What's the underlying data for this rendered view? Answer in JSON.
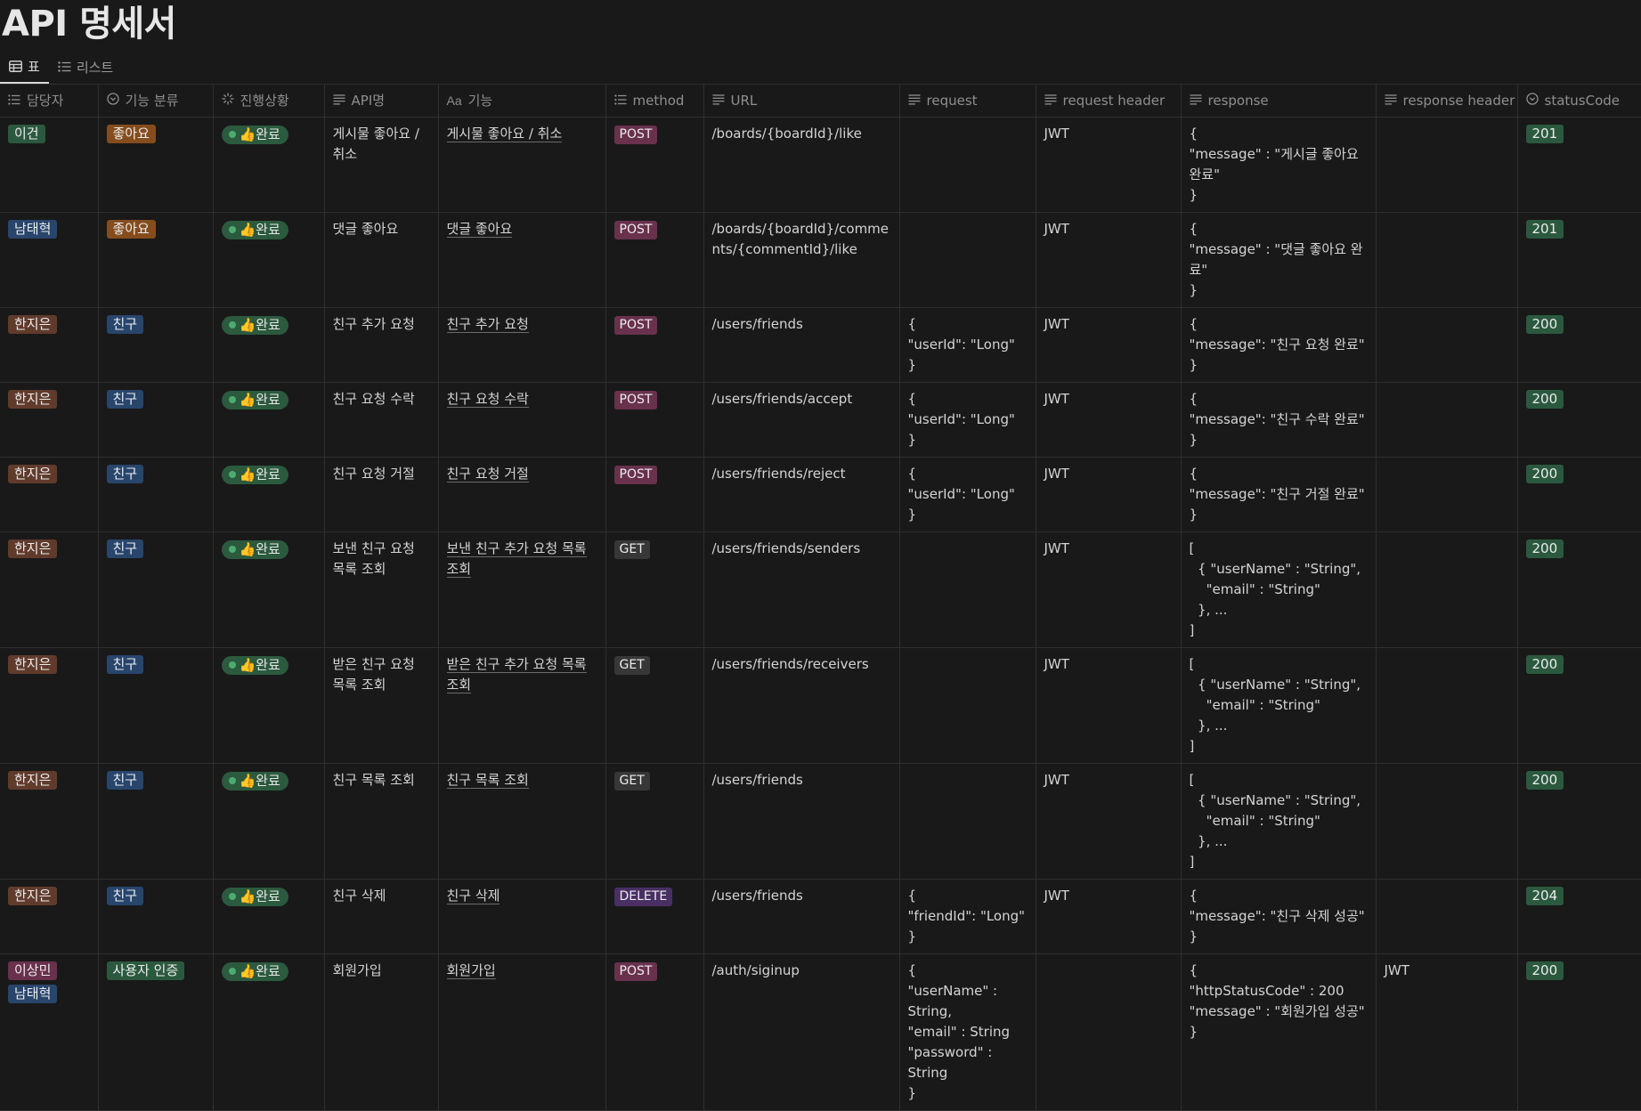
{
  "title": "API 명세서",
  "views": [
    {
      "label": "표",
      "icon": "table-icon",
      "active": true
    },
    {
      "label": "리스트",
      "icon": "list-icon",
      "active": false
    }
  ],
  "columns": [
    {
      "label": "담당자",
      "icon": "multi-select-icon"
    },
    {
      "label": "기능 분류",
      "icon": "select-icon"
    },
    {
      "label": "진행상황",
      "icon": "status-icon"
    },
    {
      "label": "API명",
      "icon": "text-icon"
    },
    {
      "label": "기능",
      "icon": "title-icon"
    },
    {
      "label": "method",
      "icon": "multi-select-icon"
    },
    {
      "label": "URL",
      "icon": "text-icon"
    },
    {
      "label": "request",
      "icon": "text-icon"
    },
    {
      "label": "request header",
      "icon": "text-icon"
    },
    {
      "label": "response",
      "icon": "text-icon"
    },
    {
      "label": "response header",
      "icon": "text-icon"
    },
    {
      "label": "statusCode",
      "icon": "select-icon"
    }
  ],
  "colors": {
    "pill_green": "#2b593f",
    "pill_brown": "#603b2c",
    "pill_blue": "#28456c",
    "pill_orange": "#854c1d",
    "pill_pink": "#69314c",
    "pill_purple": "#492f64",
    "pill_gray": "#373737",
    "status_bg": "#2b5a3e",
    "status_dot": "#4dab6f"
  },
  "rows": [
    {
      "owners": [
        {
          "label": "이건",
          "color": "green"
        }
      ],
      "category": {
        "label": "좋아요",
        "color": "orange"
      },
      "status": "👍완료",
      "api_name": "게시물 좋아요 / 취소",
      "feature": "게시물 좋아요 / 취소",
      "method": {
        "label": "POST",
        "color": "pink"
      },
      "url": "/boards/{boardId}/like",
      "request": "",
      "request_header": "JWT",
      "response": "{\n\"message\" : \"게시글 좋아요 완료\"\n}",
      "response_header": "",
      "status_code": "201"
    },
    {
      "owners": [
        {
          "label": "남태혁",
          "color": "blue"
        }
      ],
      "category": {
        "label": "좋아요",
        "color": "orange"
      },
      "status": "👍완료",
      "api_name": "댓글 좋아요",
      "feature": "댓글 좋아요",
      "method": {
        "label": "POST",
        "color": "pink"
      },
      "url": "/boards/{boardId}/comments/{commentId}/like",
      "request": "",
      "request_header": "JWT",
      "response": "{\n\"message\" : \"댓글 좋아요 완료\"\n}",
      "response_header": "",
      "status_code": "201"
    },
    {
      "owners": [
        {
          "label": "한지은",
          "color": "brown"
        }
      ],
      "category": {
        "label": "친구",
        "color": "blue"
      },
      "status": "👍완료",
      "api_name": "친구 추가 요청",
      "feature": "친구 추가 요청",
      "method": {
        "label": "POST",
        "color": "pink"
      },
      "url": "/users/friends",
      "request": "{\n\"userId\": \"Long\"\n}",
      "request_header": "JWT",
      "response": "{\n\"message\": \"친구 요청 완료\"\n}",
      "response_header": "",
      "status_code": "200"
    },
    {
      "owners": [
        {
          "label": "한지은",
          "color": "brown"
        }
      ],
      "category": {
        "label": "친구",
        "color": "blue"
      },
      "status": "👍완료",
      "api_name": "친구 요청 수락",
      "feature": "친구 요청 수락",
      "method": {
        "label": "POST",
        "color": "pink"
      },
      "url": "/users/friends/accept",
      "request": "{\n\"userId\": \"Long\"\n}",
      "request_header": "JWT",
      "response": "{\n\"message\": \"친구 수락 완료\"\n}",
      "response_header": "",
      "status_code": "200"
    },
    {
      "owners": [
        {
          "label": "한지은",
          "color": "brown"
        }
      ],
      "category": {
        "label": "친구",
        "color": "blue"
      },
      "status": "👍완료",
      "api_name": "친구 요청 거절",
      "feature": "친구 요청 거절",
      "method": {
        "label": "POST",
        "color": "pink"
      },
      "url": "/users/friends/reject",
      "request": "{\n\"userId\": \"Long\"\n}",
      "request_header": "JWT",
      "response": "{\n\"message\": \"친구 거절 완료\"\n}",
      "response_header": "",
      "status_code": "200"
    },
    {
      "owners": [
        {
          "label": "한지은",
          "color": "brown"
        }
      ],
      "category": {
        "label": "친구",
        "color": "blue"
      },
      "status": "👍완료",
      "api_name": "보낸 친구 요청 목록 조회",
      "feature": "보낸 친구 추가 요청 목록 조회",
      "method": {
        "label": "GET",
        "color": "gray"
      },
      "url": "/users/friends/senders",
      "request": "",
      "request_header": "JWT",
      "response": "[\n  { \"userName\" : \"String\",\n    \"email\" : \"String\"\n  }, ...\n]",
      "response_header": "",
      "status_code": "200"
    },
    {
      "owners": [
        {
          "label": "한지은",
          "color": "brown"
        }
      ],
      "category": {
        "label": "친구",
        "color": "blue"
      },
      "status": "👍완료",
      "api_name": "받은 친구 요청 목록 조회",
      "feature": "받은 친구 추가 요청 목록 조회",
      "method": {
        "label": "GET",
        "color": "gray"
      },
      "url": "/users/friends/receivers",
      "request": "",
      "request_header": "JWT",
      "response": "[\n  { \"userName\" : \"String\",\n    \"email\" : \"String\"\n  }, ...\n]",
      "response_header": "",
      "status_code": "200"
    },
    {
      "owners": [
        {
          "label": "한지은",
          "color": "brown"
        }
      ],
      "category": {
        "label": "친구",
        "color": "blue"
      },
      "status": "👍완료",
      "api_name": "친구 목록 조회",
      "feature": "친구 목록 조회",
      "method": {
        "label": "GET",
        "color": "gray"
      },
      "url": "/users/friends",
      "request": "",
      "request_header": "JWT",
      "response": "[\n  { \"userName\" : \"String\",\n    \"email\" : \"String\"\n  }, ...\n]",
      "response_header": "",
      "status_code": "200"
    },
    {
      "owners": [
        {
          "label": "한지은",
          "color": "brown"
        }
      ],
      "category": {
        "label": "친구",
        "color": "blue"
      },
      "status": "👍완료",
      "api_name": "친구 삭제",
      "feature": "친구 삭제",
      "method": {
        "label": "DELETE",
        "color": "purple"
      },
      "url": "/users/friends",
      "request": "{\n\"friendId\": \"Long\"\n}",
      "request_header": "JWT",
      "response": "{\n\"message\": \"친구 삭제 성공\"\n}",
      "response_header": "",
      "status_code": "204"
    },
    {
      "owners": [
        {
          "label": "이상민",
          "color": "pink"
        },
        {
          "label": "남태혁",
          "color": "blue"
        }
      ],
      "category": {
        "label": "사용자 인증",
        "color": "green"
      },
      "status": "👍완료",
      "api_name": "회원가입",
      "feature": "회원가입",
      "method": {
        "label": "POST",
        "color": "pink"
      },
      "url": "/auth/siginup",
      "request": "{\n\"userName\" : String,\n\"email\" : String\n\"password\" : String\n}",
      "request_header": "",
      "response": "{\n\"httpStatusCode\" : 200\n\"message\" : \"회원가입 성공\"\n}",
      "response_header": "JWT",
      "status_code": "200"
    }
  ]
}
